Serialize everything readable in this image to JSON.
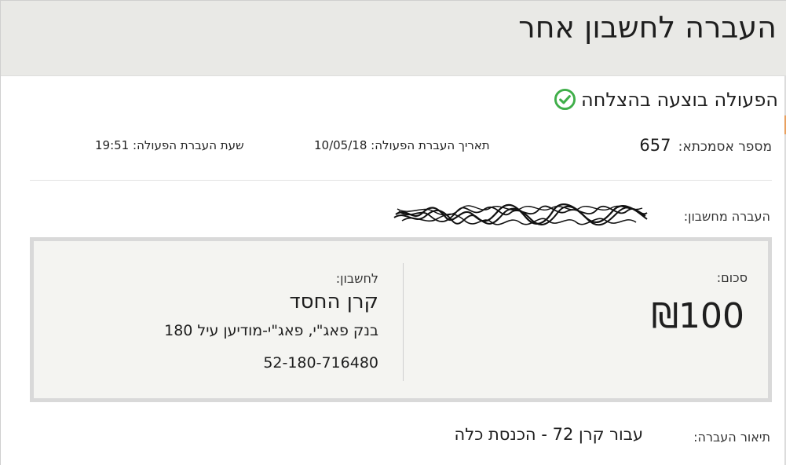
{
  "header": {
    "title": "העברה לחשבון אחר"
  },
  "status": {
    "icon": "check-circle-icon",
    "color": "#3fae49",
    "message": "הפעולה בוצעה בהצלחה"
  },
  "details": {
    "reference_label": "מספר אסמכתא:",
    "reference_value": "657",
    "date_label": "תאריך העברת הפעולה:",
    "date_value": "10/05/18",
    "time_label": "שעת העברת הפעולה:",
    "time_value": "19:51"
  },
  "from_account": {
    "label": "העברה מחשבון:"
  },
  "transfer": {
    "amount_label": "סכום:",
    "amount_value": "₪100",
    "to_label": "לחשבון:",
    "to_name": "קרן החסד",
    "to_bank": "בנק פאג\"י, פאג\"י-מודיען עיל 180",
    "to_account": "52-180-716480"
  },
  "description": {
    "label": "תיאור העברה:",
    "value": "עבור קרן 72 - הכנסת כלה"
  }
}
